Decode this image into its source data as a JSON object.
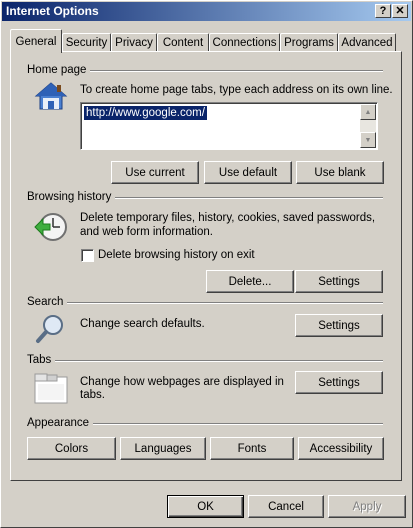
{
  "window": {
    "title": "Internet Options",
    "help_label": "?",
    "close_label": "✕"
  },
  "tabs": [
    {
      "label": "General"
    },
    {
      "label": "Security"
    },
    {
      "label": "Privacy"
    },
    {
      "label": "Content"
    },
    {
      "label": "Connections"
    },
    {
      "label": "Programs"
    },
    {
      "label": "Advanced"
    }
  ],
  "home_page": {
    "header": "Home page",
    "description": "To create home page tabs, type each address on its own line.",
    "url": "http://www.google.com/",
    "use_current": "Use current",
    "use_default": "Use default",
    "use_blank": "Use blank"
  },
  "browsing_history": {
    "header": "Browsing history",
    "description_line1": "Delete temporary files, history, cookies, saved passwords,",
    "description_line2": "and web form information.",
    "delete_on_exit_label": "Delete browsing history on exit",
    "delete_on_exit_checked": false,
    "delete_button": "Delete...",
    "settings_button": "Settings"
  },
  "search": {
    "header": "Search",
    "description": "Change search defaults.",
    "settings_button": "Settings"
  },
  "tabs_section": {
    "header": "Tabs",
    "description_line1": "Change how webpages are displayed in",
    "description_line2": "tabs.",
    "settings_button": "Settings"
  },
  "appearance": {
    "header": "Appearance",
    "colors": "Colors",
    "languages": "Languages",
    "fonts": "Fonts",
    "accessibility": "Accessibility"
  },
  "footer": {
    "ok": "OK",
    "cancel": "Cancel",
    "apply": "Apply"
  }
}
